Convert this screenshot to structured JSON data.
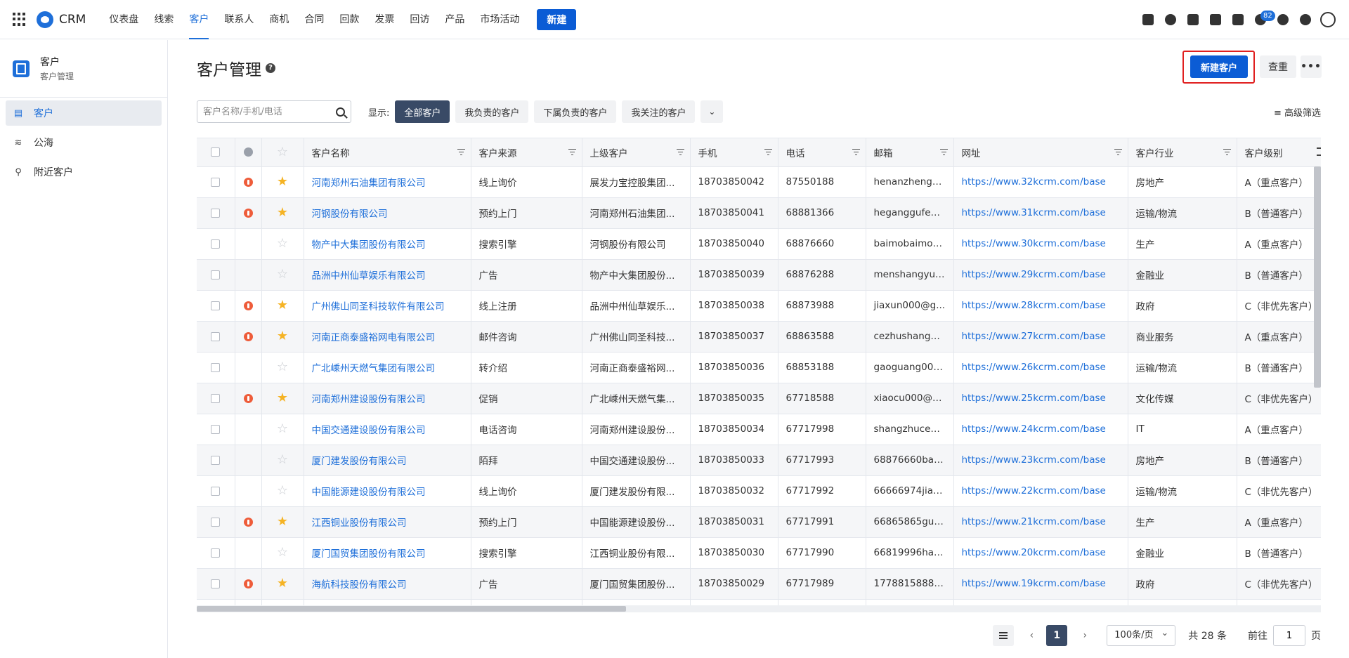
{
  "app": {
    "name": "CRM"
  },
  "nav": {
    "items": [
      "仪表盘",
      "线索",
      "客户",
      "联系人",
      "商机",
      "合同",
      "回款",
      "发票",
      "回访",
      "产品",
      "市场活动"
    ],
    "active_index": 2,
    "new_label": "新建",
    "notification_count": "82"
  },
  "sidebar": {
    "title": "客户",
    "subtitle": "客户管理",
    "items": [
      {
        "label": "客户",
        "icon": "building-icon",
        "active": true
      },
      {
        "label": "公海",
        "icon": "waves-icon",
        "active": false
      },
      {
        "label": "附近客户",
        "icon": "location-pin-icon",
        "active": false
      }
    ]
  },
  "page": {
    "title": "客户管理",
    "create_label": "新建客户",
    "dedupe_label": "查重",
    "more_label": "•••"
  },
  "filters": {
    "search_placeholder": "客户名称/手机/电话",
    "show_label": "显示:",
    "segments": [
      "全部客户",
      "我负责的客户",
      "下属负责的客户",
      "我关注的客户"
    ],
    "active_segment": 0,
    "advanced_label": "高级筛选"
  },
  "table": {
    "columns": [
      "客户名称",
      "客户来源",
      "上级客户",
      "手机",
      "电话",
      "邮箱",
      "网址",
      "客户行业",
      "客户级别"
    ],
    "rows": [
      {
        "flag": true,
        "star": true,
        "name": "河南郑州石油集团有限公司",
        "source": "线上询价",
        "parent": "展发力宝控股集团...",
        "mobile": "18703850042",
        "phone": "87550188",
        "email": "henanzhengzh...",
        "url": "https://www.32kcrm.com/base",
        "industry": "房地产",
        "level": "A（重点客户）"
      },
      {
        "flag": true,
        "star": true,
        "name": "河钢股份有限公司",
        "source": "预约上门",
        "parent": "河南郑州石油集团...",
        "mobile": "18703850041",
        "phone": "68881366",
        "email": "heganggufen...",
        "url": "https://www.31kcrm.com/base",
        "industry": "运输/物流",
        "level": "B（普通客户）"
      },
      {
        "flag": false,
        "star": false,
        "name": "物产中大集团股份有限公司",
        "source": "搜索引擎",
        "parent": "河钢股份有限公司",
        "mobile": "18703850040",
        "phone": "68876660",
        "email": "baimobaimo0...",
        "url": "https://www.30kcrm.com/base",
        "industry": "生产",
        "level": "A（重点客户）"
      },
      {
        "flag": false,
        "star": false,
        "name": "品洲中州仙草娱乐有限公司",
        "source": "广告",
        "parent": "物产中大集团股份...",
        "mobile": "18703850039",
        "phone": "68876288",
        "email": "menshangyue...",
        "url": "https://www.29kcrm.com/base",
        "industry": "金融业",
        "level": "B（普通客户）"
      },
      {
        "flag": true,
        "star": true,
        "name": "广州佛山同圣科技软件有限公司",
        "source": "线上注册",
        "parent": "品洲中州仙草娱乐...",
        "mobile": "18703850038",
        "phone": "68873988",
        "email": "jiaxun000@g...",
        "url": "https://www.28kcrm.com/base",
        "industry": "政府",
        "level": "C（非优先客户）"
      },
      {
        "flag": true,
        "star": true,
        "name": "河南正商泰盛裕网电有限公司",
        "source": "邮件咨询",
        "parent": "广州佛山同圣科技...",
        "mobile": "18703850037",
        "phone": "68863588",
        "email": "cezhushangxi...",
        "url": "https://www.27kcrm.com/base",
        "industry": "商业服务",
        "level": "A（重点客户）"
      },
      {
        "flag": false,
        "star": false,
        "name": "广北嵊州天燃气集团有限公司",
        "source": "转介绍",
        "parent": "河南正商泰盛裕网...",
        "mobile": "18703850036",
        "phone": "68853188",
        "email": "gaoguang000...",
        "url": "https://www.26kcrm.com/base",
        "industry": "运输/物流",
        "level": "B（普通客户）"
      },
      {
        "flag": true,
        "star": true,
        "name": "河南郑州建设股份有限公司",
        "source": "促销",
        "parent": "广北嵊州天燃气集...",
        "mobile": "18703850035",
        "phone": "67718588",
        "email": "xiaocu000@g...",
        "url": "https://www.25kcrm.com/base",
        "industry": "文化传媒",
        "level": "C（非优先客户）"
      },
      {
        "flag": false,
        "star": false,
        "name": "中国交通建设股份有限公司",
        "source": "电话咨询",
        "parent": "河南郑州建设股份...",
        "mobile": "18703850034",
        "phone": "67717998",
        "email": "shangzhuce00...",
        "url": "https://www.24kcrm.com/base",
        "industry": "IT",
        "level": "A（重点客户）"
      },
      {
        "flag": false,
        "star": false,
        "name": "厦门建发股份有限公司",
        "source": "陌拜",
        "parent": "中国交通建设股份...",
        "mobile": "18703850033",
        "phone": "67717993",
        "email": "68876660baol...",
        "url": "https://www.23kcrm.com/base",
        "industry": "房地产",
        "level": "B（普通客户）"
      },
      {
        "flag": false,
        "star": false,
        "name": "中国能源建设股份有限公司",
        "source": "线上询价",
        "parent": "厦门建发股份有限...",
        "mobile": "18703850032",
        "phone": "67717992",
        "email": "66666974jian...",
        "url": "https://www.22kcrm.com/base",
        "industry": "运输/物流",
        "level": "C（非优先客户）"
      },
      {
        "flag": true,
        "star": true,
        "name": "江西铜业股份有限公司",
        "source": "预约上门",
        "parent": "中国能源建设股份...",
        "mobile": "18703850031",
        "phone": "67717991",
        "email": "66865865guo...",
        "url": "https://www.21kcrm.com/base",
        "industry": "生产",
        "level": "A（重点客户）"
      },
      {
        "flag": false,
        "star": false,
        "name": "厦门国贸集团股份有限公司",
        "source": "搜索引擎",
        "parent": "江西铜业股份有限...",
        "mobile": "18703850030",
        "phone": "67717990",
        "email": "66819996hang...",
        "url": "https://www.20kcrm.com/base",
        "industry": "金融业",
        "level": "B（普通客户）"
      },
      {
        "flag": true,
        "star": true,
        "name": "海航科技股份有限公司",
        "source": "广告",
        "parent": "厦门国贸集团股份...",
        "mobile": "18703850029",
        "phone": "67717989",
        "email": "17788158888y...",
        "url": "https://www.19kcrm.com/base",
        "industry": "政府",
        "level": "C（非优先客户）"
      },
      {
        "flag": false,
        "star": false,
        "name": "",
        "source": "",
        "parent": "",
        "mobile": "",
        "phone": "",
        "email": "",
        "url": "",
        "industry": "",
        "level": ""
      }
    ]
  },
  "pagination": {
    "current_page": "1",
    "page_size": "100条/页",
    "total": "共 28 条",
    "goto_label": "前往",
    "goto_value": "1",
    "page_suffix": "页"
  },
  "colors": {
    "primary": "#0b5cd5",
    "link": "#1e6fd9",
    "segment_active": "#394a66",
    "highlight_border": "#e02020",
    "flag": "#ee5c3a",
    "star": "#f5b324"
  }
}
